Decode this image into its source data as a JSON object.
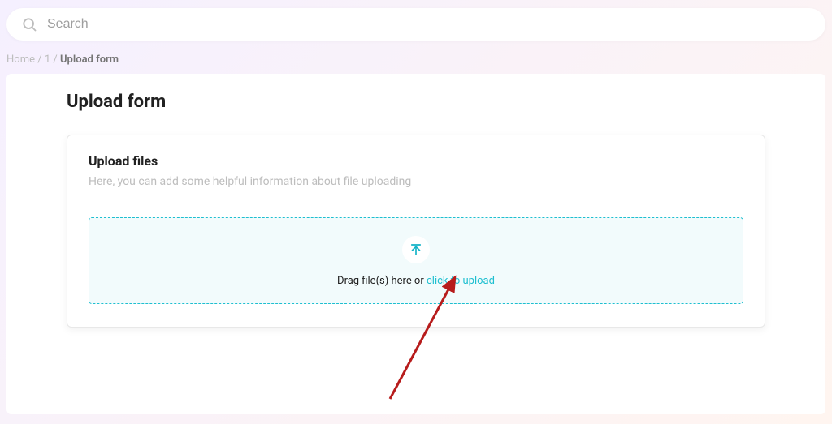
{
  "search": {
    "placeholder": "Search"
  },
  "breadcrumb": {
    "items": [
      "Home",
      "1"
    ],
    "current": "Upload form",
    "separator": "/"
  },
  "page": {
    "title": "Upload form"
  },
  "card": {
    "title": "Upload files",
    "subtitle": "Here, you can add some helpful information about file uploading"
  },
  "dropzone": {
    "text_prefix": "Drag file(s) here or ",
    "link_text": "click to upload"
  },
  "colors": {
    "accent": "#1fbfd0",
    "annotation": "#b71c1c"
  }
}
